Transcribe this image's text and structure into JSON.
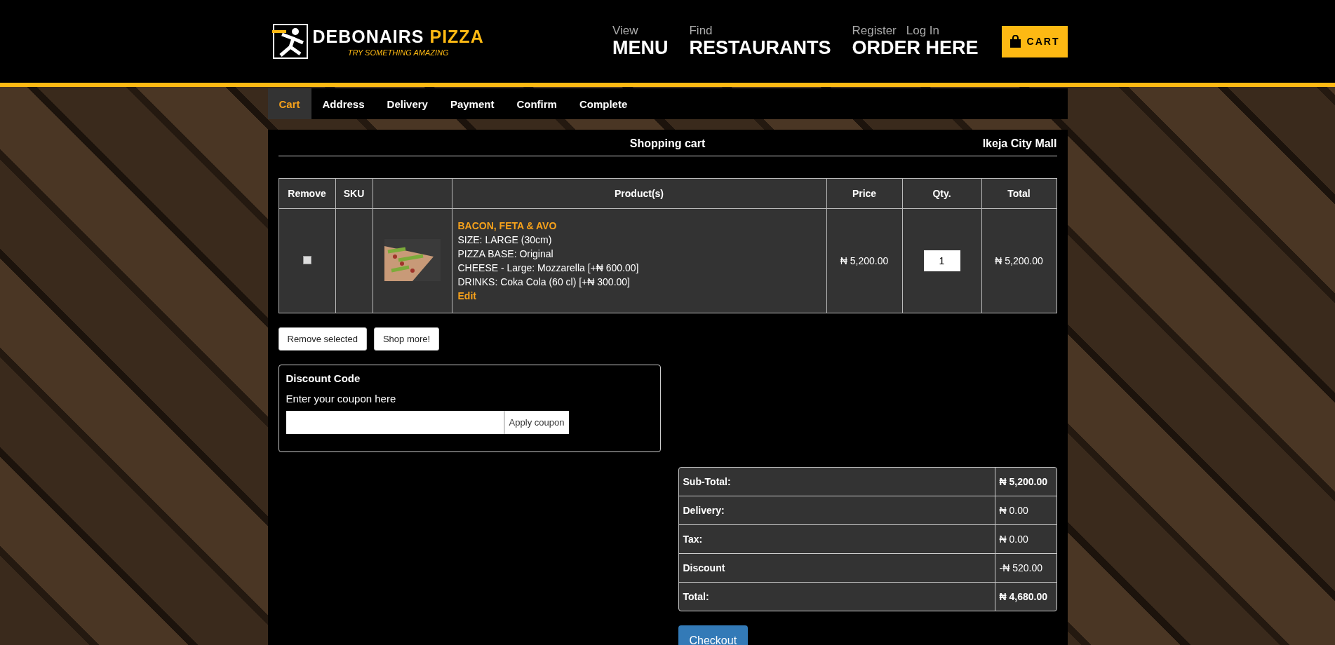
{
  "header": {
    "logo": {
      "name": "DEBONAIRS",
      "accent": "PIZZA",
      "tagline": "TRY SOMETHING AMAZING"
    },
    "nav": [
      {
        "small": "View",
        "big": "MENU"
      },
      {
        "small": "Find",
        "big": "RESTAURANTS"
      }
    ],
    "account": {
      "links": [
        "Register",
        "Log In"
      ],
      "big": "ORDER HERE"
    },
    "cart_button": "CART"
  },
  "steps": [
    {
      "label": "Cart",
      "selected": true
    },
    {
      "label": "Address",
      "selected": false
    },
    {
      "label": "Delivery",
      "selected": false
    },
    {
      "label": "Payment",
      "selected": false
    },
    {
      "label": "Confirm",
      "selected": false
    },
    {
      "label": "Complete",
      "selected": false
    }
  ],
  "cart": {
    "title": "Shopping cart",
    "store": "Ikeja City Mall",
    "columns": [
      "Remove",
      "SKU",
      "Product(s)",
      "Price",
      "Qty.",
      "Total"
    ],
    "rows": [
      {
        "checked": false,
        "name": "BACON, FETA & AVO",
        "options": [
          "SIZE: LARGE (30cm)",
          "PIZZA BASE: Original",
          "CHEESE - Large: Mozzarella [+₦ 600.00]",
          "DRINKS: Coka Cola (60 cl) [+₦ 300.00]"
        ],
        "edit": "Edit",
        "price": "₦ 5,200.00",
        "qty": "1",
        "total": "₦ 5,200.00"
      }
    ],
    "buttons": [
      "Remove selected",
      "Shop more!"
    ],
    "discount": {
      "title": "Discount Code",
      "prompt": "Enter your coupon here",
      "button": "Apply coupon"
    },
    "totals": [
      {
        "label": "Sub-Total:",
        "value": "₦ 5,200.00"
      },
      {
        "label": "Delivery:",
        "value": "₦ 0.00"
      },
      {
        "label": "Tax:",
        "value": "₦ 0.00"
      },
      {
        "label": "Discount",
        "value": "-₦ 520.00"
      },
      {
        "label": "Total:",
        "value": "₦ 4,680.00"
      }
    ],
    "checkout": "Checkout"
  }
}
